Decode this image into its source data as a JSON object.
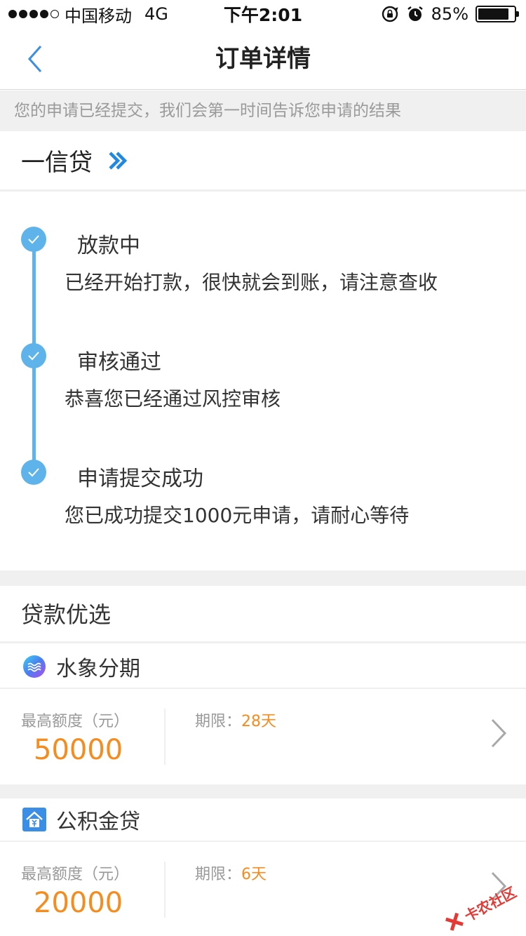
{
  "status_bar": {
    "carrier": "中国移动",
    "network": "4G",
    "time": "下午2:01",
    "battery": "85%",
    "battery_level": 0.85
  },
  "nav": {
    "title": "订单详情"
  },
  "notice": "您的申请已经提交，我们会第一时间告诉您申请的结果",
  "product": {
    "name": "一信贷"
  },
  "timeline": [
    {
      "title": "放款中",
      "desc": "已经开始打款，很快就会到账，请注意查收"
    },
    {
      "title": "审核通过",
      "desc": "恭喜您已经通过风控审核"
    },
    {
      "title": "申请提交成功",
      "desc": "您已成功提交1000元申请，请耐心等待"
    }
  ],
  "recommend": {
    "section_title": "贷款优选",
    "items": [
      {
        "name": "水象分期",
        "amount_label": "最高额度（元）",
        "amount": "50000",
        "term_label": "期限：",
        "term": "28天"
      },
      {
        "name": "公积金贷",
        "amount_label": "最高额度（元）",
        "amount": "20000",
        "term_label": "期限：",
        "term": "6天"
      }
    ]
  },
  "watermark": "卡农社区",
  "colors": {
    "accent_blue": "#5db3ea",
    "amount_orange": "#f68b1e",
    "product_icon_blue": "#1e88e5"
  }
}
